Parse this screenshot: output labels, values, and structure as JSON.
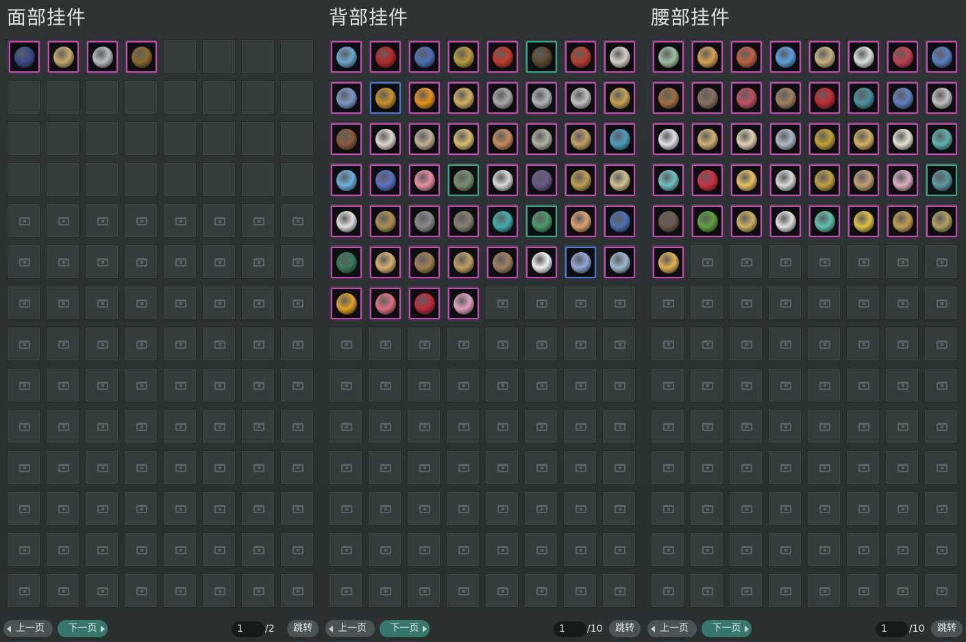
{
  "panels": [
    {
      "title": "面部挂件",
      "filled_slots": 32,
      "items": [
        {
          "icon": "blue-red-mask-icon",
          "color": "#3a4a8a",
          "frame": "magenta"
        },
        {
          "icon": "golden-tablet-icon",
          "color": "#c9a86a",
          "frame": "magenta"
        },
        {
          "icon": "silver-mask-icon",
          "color": "#b9bcc0",
          "frame": "magenta"
        },
        {
          "icon": "monocle-chain-icon",
          "color": "#8a6a2a",
          "frame": "magenta"
        }
      ],
      "prev_label": "上一页",
      "next_label": "下一页",
      "page_current": "1",
      "page_total": "/2",
      "jump_label": "跳转"
    },
    {
      "title": "背部挂件",
      "filled_slots": 52,
      "items": [
        {
          "icon": "ship-globe-icon",
          "color": "#6aa8d0",
          "frame": "magenta"
        },
        {
          "icon": "red-scroll-icon",
          "color": "#b8282a",
          "frame": "magenta"
        },
        {
          "icon": "blue-sword-icon",
          "color": "#4a70b8",
          "frame": "magenta"
        },
        {
          "icon": "golden-spear-icon",
          "color": "#b89a3a",
          "frame": "magenta"
        },
        {
          "icon": "red-parrot-icon",
          "color": "#c43a2a",
          "frame": "magenta"
        },
        {
          "icon": "feather-fan-icon",
          "color": "#5a4a2a",
          "frame": "teal"
        },
        {
          "icon": "red-lantern-icon",
          "color": "#b8402a",
          "frame": "magenta"
        },
        {
          "icon": "white-flower-icon",
          "color": "#d8d0c8",
          "frame": "magenta"
        },
        {
          "icon": "blue-dagger-icon",
          "color": "#7a98c8",
          "frame": "magenta"
        },
        {
          "icon": "golden-lute-icon",
          "color": "#c8902a",
          "frame": "blue"
        },
        {
          "icon": "sun-wheel-icon",
          "color": "#e8901a",
          "frame": "magenta"
        },
        {
          "icon": "golden-blade-icon",
          "color": "#d0b060",
          "frame": "magenta"
        },
        {
          "icon": "silver-fan-icon",
          "color": "#a8a8a8",
          "frame": "magenta"
        },
        {
          "icon": "silver-teapot-icon",
          "color": "#b0b4b8",
          "frame": "magenta"
        },
        {
          "icon": "thorn-ring-icon",
          "color": "#c0c0c0",
          "frame": "magenta"
        },
        {
          "icon": "pagoda-lantern-icon",
          "color": "#c8a050",
          "frame": "magenta"
        },
        {
          "icon": "bronze-rack-icon",
          "color": "#8a5a3a",
          "frame": "magenta"
        },
        {
          "icon": "white-doll-icon",
          "color": "#e0d8d0",
          "frame": "magenta"
        },
        {
          "icon": "dreamcatcher-icon",
          "color": "#c0b090",
          "frame": "magenta"
        },
        {
          "icon": "flower-basket-icon",
          "color": "#d8b870",
          "frame": "magenta"
        },
        {
          "icon": "copper-lantern-icon",
          "color": "#c88a5a",
          "frame": "magenta"
        },
        {
          "icon": "wind-chime-icon",
          "color": "#b0b0a0",
          "frame": "magenta"
        },
        {
          "icon": "hanging-gourd-icon",
          "color": "#c0a060",
          "frame": "magenta"
        },
        {
          "icon": "kingfisher-icon",
          "color": "#4aa0c0",
          "frame": "magenta"
        },
        {
          "icon": "blue-swirl-icon",
          "color": "#6ab0e0",
          "frame": "magenta"
        },
        {
          "icon": "rune-orb-icon",
          "color": "#5a70c0",
          "frame": "magenta"
        },
        {
          "icon": "flower-umbrella-icon",
          "color": "#e890a0",
          "frame": "magenta"
        },
        {
          "icon": "bookcase-icon",
          "color": "#7a9070",
          "frame": "teal"
        },
        {
          "icon": "white-crane-icon",
          "color": "#d8d8d8",
          "frame": "magenta"
        },
        {
          "icon": "purple-globe-icon",
          "color": "#6a5a8a",
          "frame": "magenta"
        },
        {
          "icon": "golden-bird-icon",
          "color": "#c0a050",
          "frame": "magenta"
        },
        {
          "icon": "hanging-ornaments-icon",
          "color": "#d0c090",
          "frame": "magenta"
        },
        {
          "icon": "white-flag-icon",
          "color": "#e0e0e0",
          "frame": "magenta"
        },
        {
          "icon": "wicker-basket-icon",
          "color": "#b09050",
          "frame": "magenta"
        },
        {
          "icon": "iron-sword-icon",
          "color": "#8a8a8a",
          "frame": "magenta"
        },
        {
          "icon": "long-rifle-icon",
          "color": "#8a8070",
          "frame": "magenta"
        },
        {
          "icon": "teal-balloons-icon",
          "color": "#40b0b0",
          "frame": "magenta"
        },
        {
          "icon": "green-leaves-icon",
          "color": "#4a9a6a",
          "frame": "teal"
        },
        {
          "icon": "chibi-girl-icon",
          "color": "#e0a070",
          "frame": "magenta"
        },
        {
          "icon": "blue-cabinet-icon",
          "color": "#4a70b0",
          "frame": "magenta"
        },
        {
          "icon": "green-harp-icon",
          "color": "#3a7a5a",
          "frame": "magenta"
        },
        {
          "icon": "pipa-lute-icon",
          "color": "#d8b070",
          "frame": "magenta"
        },
        {
          "icon": "bronze-staff-icon",
          "color": "#a08050",
          "frame": "magenta"
        },
        {
          "icon": "golden-clock-icon",
          "color": "#c0a060",
          "frame": "magenta"
        },
        {
          "icon": "golden-bow-icon",
          "color": "#a08060",
          "frame": "magenta"
        },
        {
          "icon": "white-penguin-icon",
          "color": "#f0f0f0",
          "frame": "magenta"
        },
        {
          "icon": "snowflake-wheel-icon",
          "color": "#90a8d8",
          "frame": "blue"
        },
        {
          "icon": "ice-dragon-icon",
          "color": "#9ab8d0",
          "frame": "magenta"
        },
        {
          "icon": "golden-wings-icon",
          "color": "#e0a020",
          "frame": "magenta"
        },
        {
          "icon": "peach-fruit-icon",
          "color": "#e07080",
          "frame": "magenta"
        },
        {
          "icon": "red-dress-girl-icon",
          "color": "#c02a3a",
          "frame": "magenta"
        },
        {
          "icon": "plum-blossom-icon",
          "color": "#e0a0c0",
          "frame": "magenta"
        }
      ],
      "prev_label": "上一页",
      "next_label": "下一页",
      "page_current": "1",
      "page_total": "/10",
      "jump_label": "跳转"
    },
    {
      "title": "腰部挂件",
      "filled_slots": 41,
      "items": [
        {
          "icon": "jade-plate-icon",
          "color": "#a0c0a0",
          "frame": "magenta"
        },
        {
          "icon": "hanging-gourd-icon",
          "color": "#d8a050",
          "frame": "magenta"
        },
        {
          "icon": "fruit-basket-icon",
          "color": "#c06040",
          "frame": "magenta"
        },
        {
          "icon": "blue-orb-icon",
          "color": "#5aa0e0",
          "frame": "magenta"
        },
        {
          "icon": "shell-spiral-icon",
          "color": "#c8b080",
          "frame": "magenta"
        },
        {
          "icon": "lotus-flower-icon",
          "color": "#d8e0e0",
          "frame": "magenta"
        },
        {
          "icon": "red-tassel-icon",
          "color": "#c04050",
          "frame": "magenta"
        },
        {
          "icon": "blue-ring-icon",
          "color": "#5a80c0",
          "frame": "magenta"
        },
        {
          "icon": "bronze-teapot-icon",
          "color": "#a07040",
          "frame": "magenta"
        },
        {
          "icon": "short-sword-icon",
          "color": "#8a7060",
          "frame": "magenta"
        },
        {
          "icon": "red-brush-icon",
          "color": "#c05060",
          "frame": "magenta"
        },
        {
          "icon": "crossbow-icon",
          "color": "#a08060",
          "frame": "magenta"
        },
        {
          "icon": "red-drum-icon",
          "color": "#c02a30",
          "frame": "magenta"
        },
        {
          "icon": "teal-bottle-icon",
          "color": "#4a90a0",
          "frame": "magenta"
        },
        {
          "icon": "blue-vase-icon",
          "color": "#6080c0",
          "frame": "magenta"
        },
        {
          "icon": "silver-claw-icon",
          "color": "#c0c0c0",
          "frame": "magenta"
        },
        {
          "icon": "white-flower-icon",
          "color": "#e0e0e8",
          "frame": "magenta"
        },
        {
          "icon": "golden-horn-icon",
          "color": "#d0b070",
          "frame": "magenta"
        },
        {
          "icon": "open-book-icon",
          "color": "#e0d0b0",
          "frame": "magenta"
        },
        {
          "icon": "silver-pendant-icon",
          "color": "#b0b8c8",
          "frame": "magenta"
        },
        {
          "icon": "golden-crossbow-icon",
          "color": "#c0a030",
          "frame": "magenta"
        },
        {
          "icon": "golden-cart-icon",
          "color": "#d0b060",
          "frame": "magenta"
        },
        {
          "icon": "white-sachet-icon",
          "color": "#e8e0d0",
          "frame": "magenta"
        },
        {
          "icon": "teal-compass-icon",
          "color": "#60b0b0",
          "frame": "magenta"
        },
        {
          "icon": "teal-fan-icon",
          "color": "#70c0c0",
          "frame": "magenta"
        },
        {
          "icon": "red-strawberry-icon",
          "color": "#d03040",
          "frame": "magenta"
        },
        {
          "icon": "golden-egg-icon",
          "color": "#e8c060",
          "frame": "magenta"
        },
        {
          "icon": "white-bottle-icon",
          "color": "#d8d8d8",
          "frame": "magenta"
        },
        {
          "icon": "bead-tassel-icon",
          "color": "#c0a040",
          "frame": "magenta"
        },
        {
          "icon": "pagoda-charm-icon",
          "color": "#c0a070",
          "frame": "magenta"
        },
        {
          "icon": "flower-fairy-icon",
          "color": "#e0b0c0",
          "frame": "magenta"
        },
        {
          "icon": "teal-vase-icon",
          "color": "#5a9aa0",
          "frame": "teal"
        },
        {
          "icon": "dark-scepter-icon",
          "color": "#6a5a4a",
          "frame": "magenta"
        },
        {
          "icon": "green-pepper-icon",
          "color": "#60a040",
          "frame": "magenta"
        },
        {
          "icon": "golden-scroll-icon",
          "color": "#d0b060",
          "frame": "magenta"
        },
        {
          "icon": "white-brush-icon",
          "color": "#e0e0e0",
          "frame": "magenta"
        },
        {
          "icon": "teal-fish-icon",
          "color": "#60c0b0",
          "frame": "magenta"
        },
        {
          "icon": "golden-coin-icon",
          "color": "#e0c040",
          "frame": "magenta"
        },
        {
          "icon": "golden-charm-icon",
          "color": "#c0a050",
          "frame": "magenta"
        },
        {
          "icon": "bamboo-charm-icon",
          "color": "#b0a060",
          "frame": "magenta"
        },
        {
          "icon": "golden-scroll-icon",
          "color": "#e0b050",
          "frame": "magenta"
        }
      ],
      "prev_label": "上一页",
      "next_label": "下一页",
      "page_current": "1",
      "page_total": "/10",
      "jump_label": "跳转"
    }
  ]
}
